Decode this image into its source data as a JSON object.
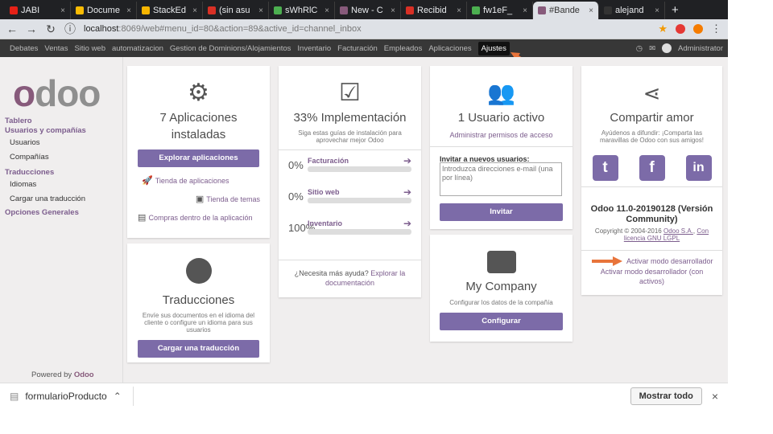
{
  "browser": {
    "tabs": [
      {
        "label": "JABI",
        "color": "#e62117"
      },
      {
        "label": "Docume",
        "color": "#fbbc04"
      },
      {
        "label": "StackEd",
        "color": "#f7b500"
      },
      {
        "label": "(sin asu",
        "color": "#d93025"
      },
      {
        "label": "sWhRlC",
        "color": "#4caf50"
      },
      {
        "label": "New - C",
        "color": "#875a7b"
      },
      {
        "label": "Recibid",
        "color": "#d93025"
      },
      {
        "label": "fw1eF_",
        "color": "#4caf50"
      },
      {
        "label": "#Bande",
        "color": "#875a7b"
      },
      {
        "label": "alejand",
        "color": "#333333"
      }
    ],
    "active_tab_index": 8,
    "url_host": "localhost",
    "url_rest": ":8069/web#menu_id=80&action=89&active_id=channel_inbox"
  },
  "menu": {
    "items": [
      "Debates",
      "Ventas",
      "Sitio web",
      "automatizacion",
      "Gestion de Dominions/Alojamientos",
      "Inventario",
      "Facturación",
      "Empleados",
      "Aplicaciones",
      "Ajustes"
    ],
    "user": "Administrator"
  },
  "sidebar": {
    "logo_first": "o",
    "logo_rest": "doo",
    "dashboard": "Tablero",
    "users_section": "Usuarios y compañías",
    "users": "Usuarios",
    "companies": "Compañías",
    "translations_section": "Traducciones",
    "languages": "Idiomas",
    "load_translation": "Cargar una traducción",
    "general": "Opciones Generales",
    "powered_prefix": "Powered by",
    "powered_brand": "Odoo"
  },
  "apps_card": {
    "title": "7 Aplicaciones instaladas",
    "button": "Explorar aplicaciones",
    "app_store": "Tienda de aplicaciones",
    "theme_store": "Tienda de temas",
    "in_app": "Compras dentro de la aplicación"
  },
  "translations_card": {
    "title": "Traducciones",
    "desc": "Envíe sus documentos en el idioma del cliente o configure un idioma para sus usuarios",
    "button": "Cargar una traducción"
  },
  "impl_card": {
    "title": "33% Implementación",
    "desc": "Siga estas guías de instalación para aprovechar mejor Odoo",
    "rows": [
      {
        "pct": "0%",
        "label": "Facturación",
        "fill": 0
      },
      {
        "pct": "0%",
        "label": "Sitio web",
        "fill": 0
      },
      {
        "pct": "100%",
        "label": "Inventario",
        "fill": 100
      }
    ],
    "help_prefix": "¿Necesita más ayuda?",
    "help_link": "Explorar la documentación"
  },
  "users_card": {
    "title": "1 Usuario activo",
    "manage": "Administrar permisos de acceso",
    "invite_label": "Invitar a nuevos usuarios:",
    "invite_placeholder": "Introduzca direcciones e-mail (una por línea)",
    "button": "Invitar"
  },
  "company_card": {
    "title": "My Company",
    "desc": "Configurar los datos de la compañía",
    "button": "Configurar"
  },
  "share_card": {
    "title": "Compartir amor",
    "desc": "Ayúdenos a difundir: ¡Comparta las maravillas de Odoo con sus amigos!",
    "version": "Odoo 11.0-20190128 (Versión Community)",
    "copyright_prefix": "Copyright © 2004-2016",
    "copyright_link": "Odoo S.A.",
    "license": "Con licencia GNU LGPL",
    "dev_mode": "Activar modo desarrollador",
    "dev_mode_assets": "Activar modo desarrollador (con activos)"
  },
  "downloads": {
    "file": "formularioProducto",
    "show_all": "Mostrar todo"
  },
  "colors": {
    "accent": "#7c6ba8",
    "brand": "#875a7b",
    "arrow": "#e8743b"
  }
}
